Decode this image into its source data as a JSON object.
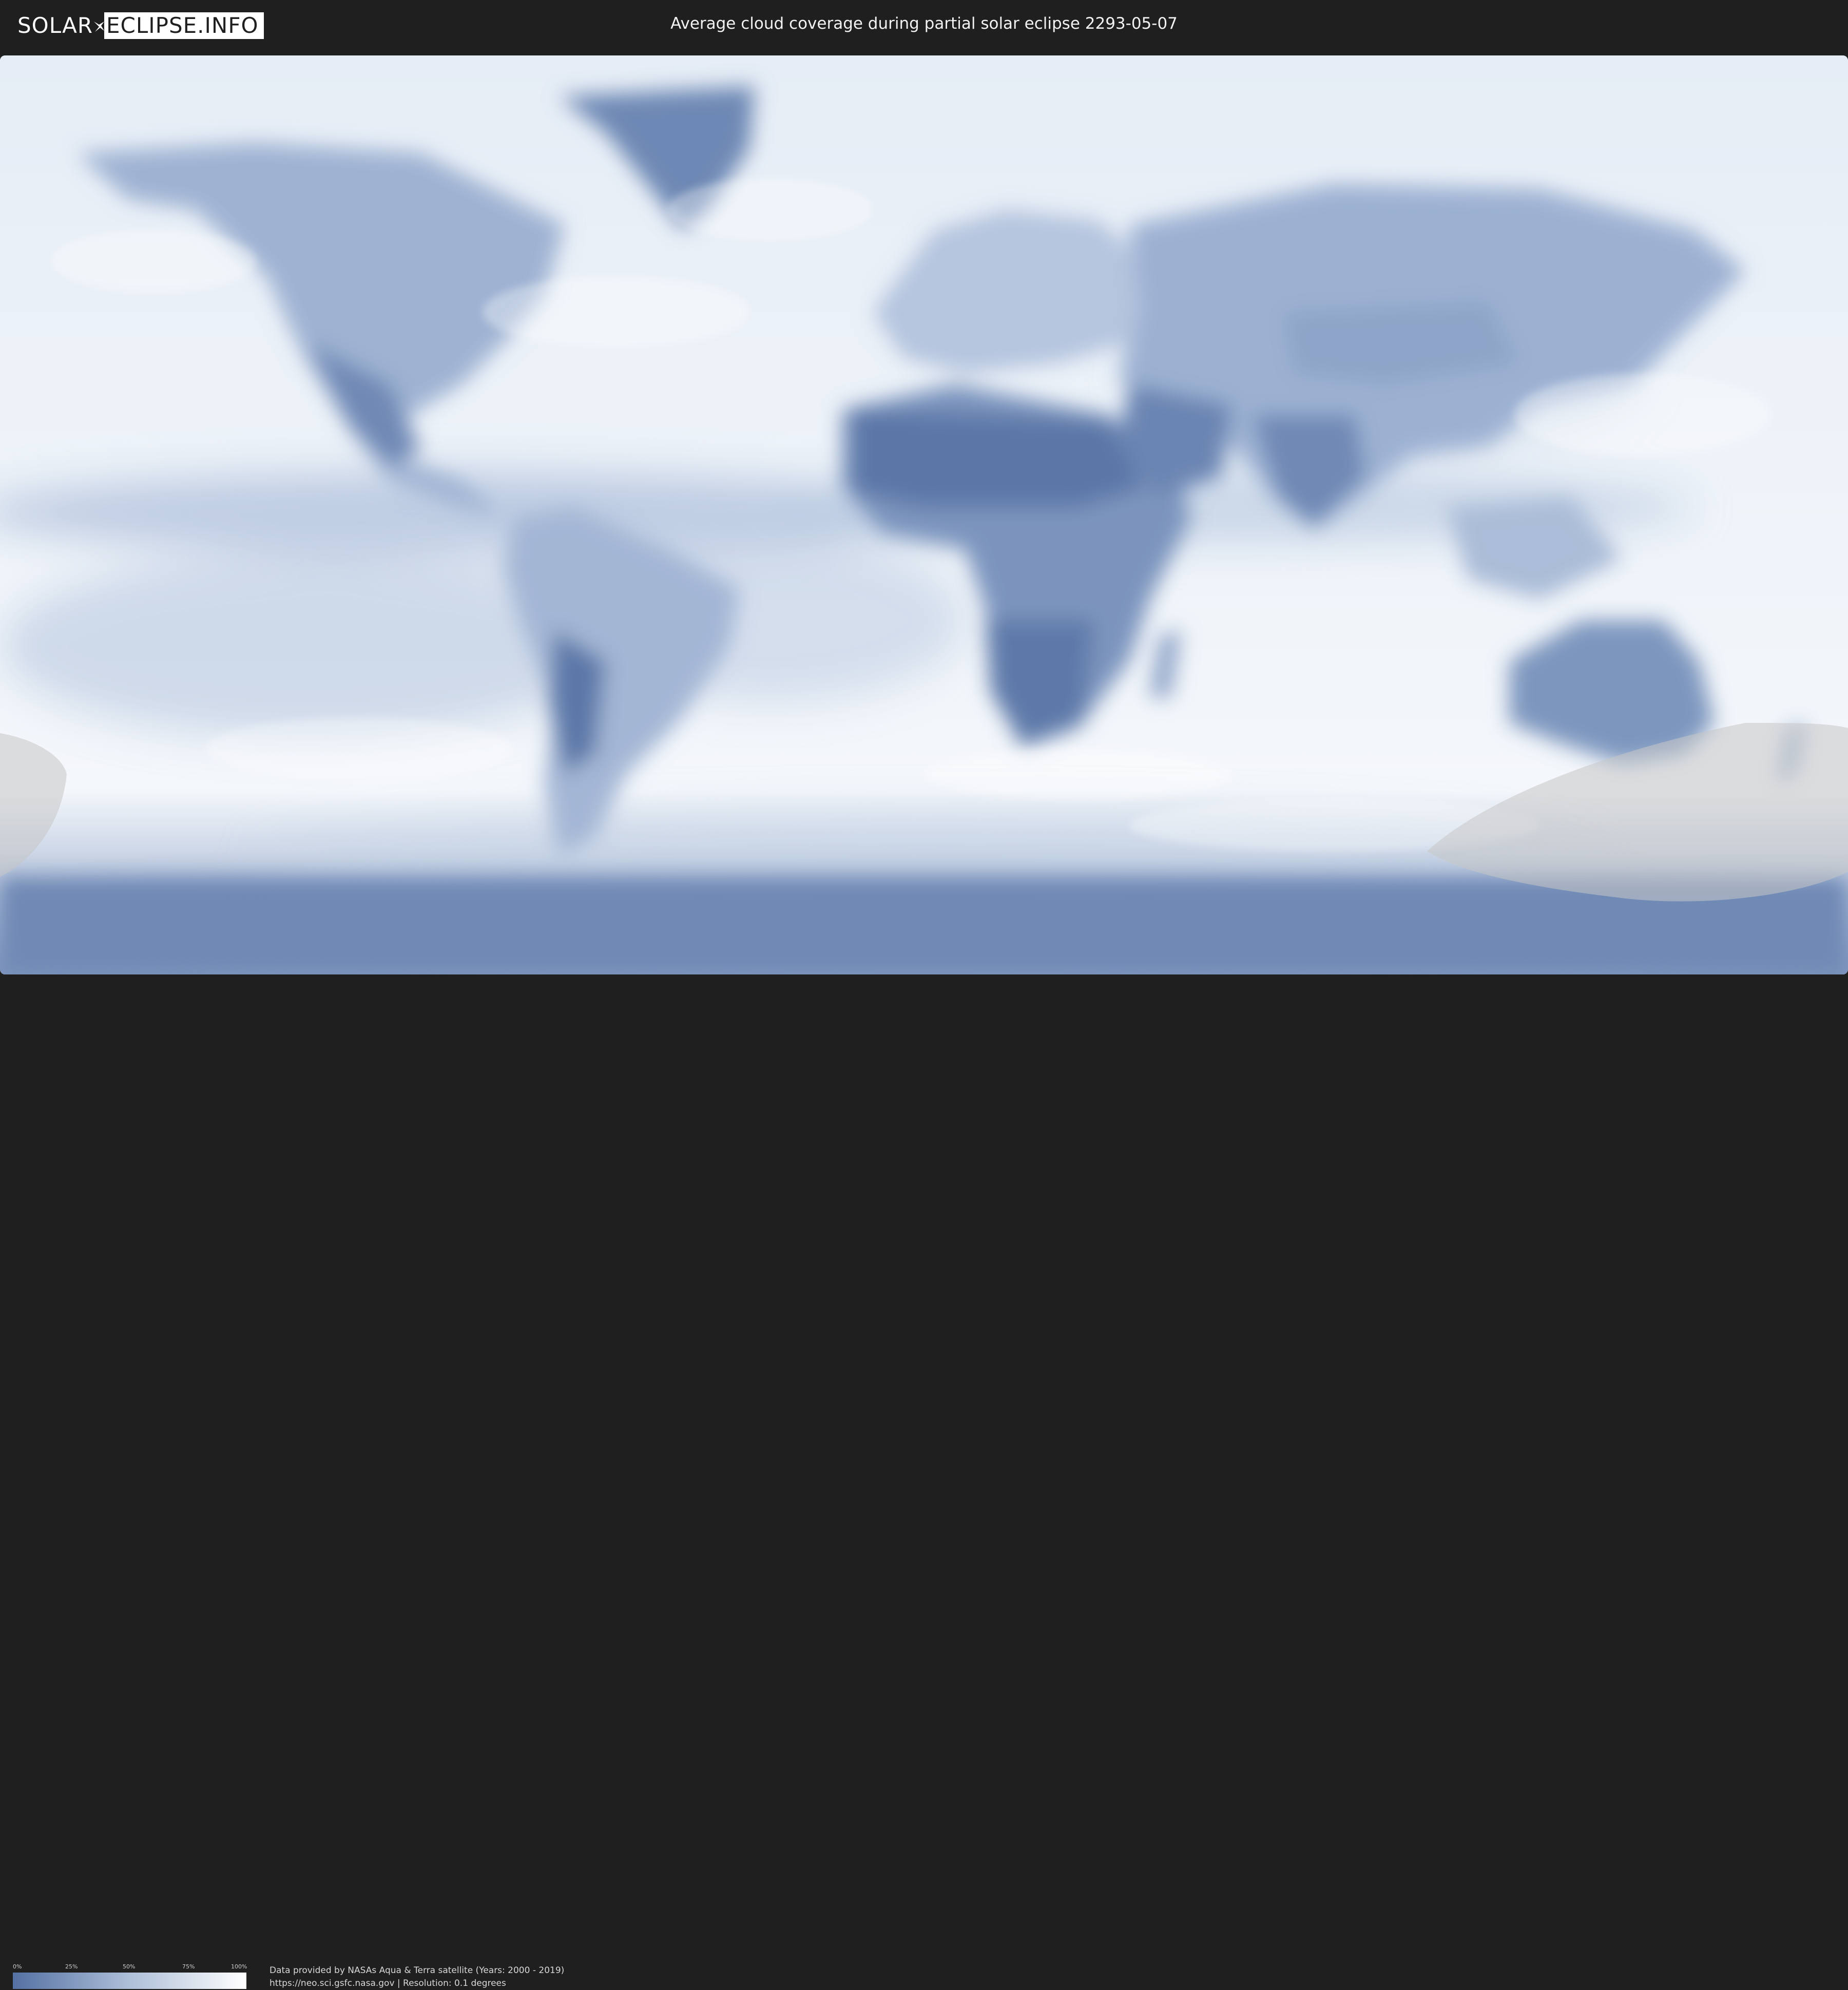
{
  "header": {
    "logo_left": "SOLAR",
    "logo_right": "ECLIPSE.INFO",
    "title": "Average cloud coverage during partial solar eclipse 2293-05-07"
  },
  "map": {
    "type": "world cloud coverage map (equirectangular)",
    "eclipse_overlay": "partial eclipse visibility shading",
    "colors": {
      "clear": "#5471a3",
      "cloudy": "#ffffff",
      "eclipse_shade": "#d0d0d0"
    }
  },
  "legend": {
    "ticks": [
      "0%",
      "25%",
      "50%",
      "75%",
      "100%"
    ],
    "gradient_from": "#5471a3",
    "gradient_to": "#ffffff"
  },
  "footer": {
    "credit_line": "Data provided by NASAs Aqua & Terra satellite (Years: 2000 - 2019)",
    "source_line": "https://neo.sci.gsfc.nasa.gov | Resolution: 0.1 degrees"
  }
}
